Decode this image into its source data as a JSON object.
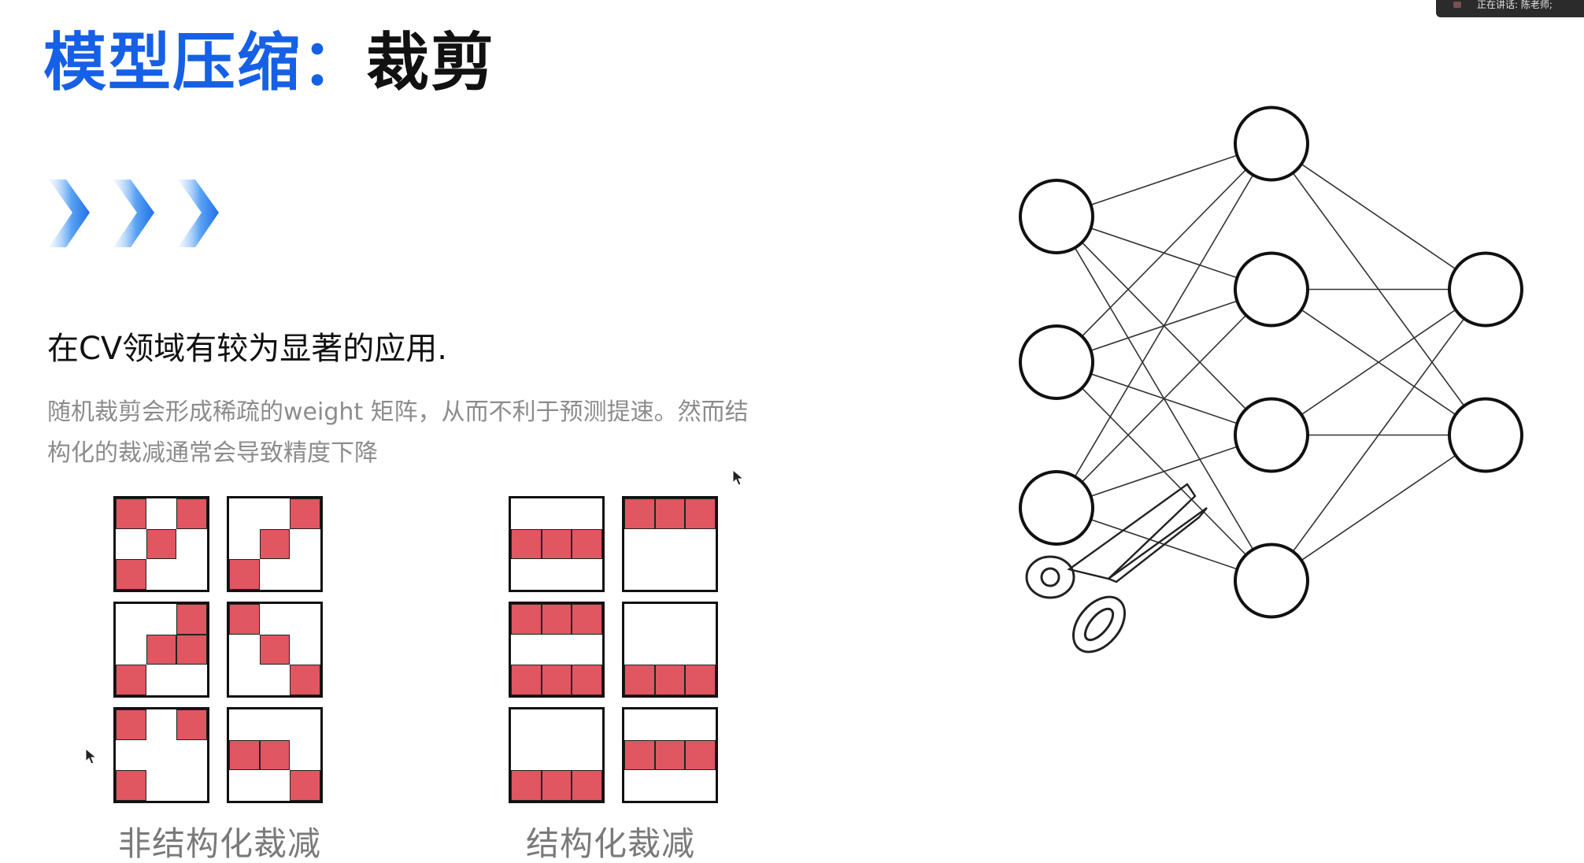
{
  "slide": {
    "title_highlight": "模型压缩",
    "title_separator": "：",
    "title_rest": "裁剪",
    "subtitle": "在CV领域有较为显著的应用.",
    "description": "随机裁剪会形成稀疏的weight 矩阵，从而不利于预测提速。然而结构化的裁减通常会导致精度下降",
    "accent_color": "#1560e6",
    "pruned_color": "#e05661"
  },
  "screen_share_badge": {
    "text": "正在讲话: 陈老师;"
  },
  "unstructured_pruning": {
    "caption": "非结构化裁减",
    "patterns": [
      [
        1,
        0,
        1,
        0,
        1,
        0,
        1,
        0,
        0
      ],
      [
        0,
        0,
        1,
        0,
        1,
        0,
        1,
        0,
        0
      ],
      [
        0,
        0,
        1,
        0,
        1,
        1,
        1,
        0,
        0
      ],
      [
        1,
        0,
        0,
        0,
        1,
        0,
        0,
        0,
        1
      ],
      [
        1,
        0,
        1,
        0,
        0,
        0,
        1,
        0,
        0
      ],
      [
        0,
        0,
        0,
        1,
        1,
        0,
        0,
        0,
        1
      ]
    ]
  },
  "structured_pruning": {
    "caption": "结构化裁减",
    "patterns": [
      [
        0,
        0,
        0,
        1,
        1,
        1,
        0,
        0,
        0
      ],
      [
        1,
        1,
        1,
        0,
        0,
        0,
        0,
        0,
        0
      ],
      [
        1,
        1,
        1,
        0,
        0,
        0,
        1,
        1,
        1
      ],
      [
        0,
        0,
        0,
        0,
        0,
        0,
        1,
        1,
        1
      ],
      [
        0,
        0,
        0,
        0,
        0,
        0,
        1,
        1,
        1
      ],
      [
        0,
        0,
        0,
        1,
        1,
        1,
        0,
        0,
        0
      ]
    ]
  },
  "neural_network": {
    "layers": [
      3,
      4,
      2
    ],
    "icon": "scissors-icon"
  }
}
